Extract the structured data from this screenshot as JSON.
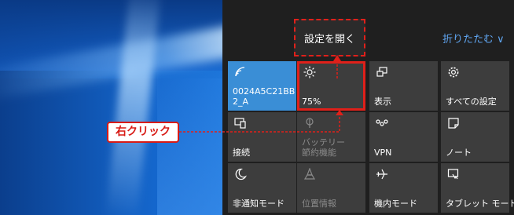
{
  "settings_popup": {
    "label": "設定を開く"
  },
  "collapse": {
    "label": "折りたたむ ∨"
  },
  "callout": {
    "label": "右クリック"
  },
  "tiles": [
    {
      "label": "0024A5C21BB\n2_A",
      "icon": "wifi-icon",
      "state": "active"
    },
    {
      "label": "75%",
      "icon": "brightness-icon",
      "state": "normal"
    },
    {
      "label": "表示",
      "icon": "project-icon",
      "state": "normal"
    },
    {
      "label": "すべての設定",
      "icon": "gear-icon",
      "state": "normal"
    },
    {
      "label": "接続",
      "icon": "connect-icon",
      "state": "normal"
    },
    {
      "label": "バッテリー\n節約機能",
      "icon": "battery-saver-icon",
      "state": "disabled"
    },
    {
      "label": "VPN",
      "icon": "vpn-icon",
      "state": "normal"
    },
    {
      "label": "ノート",
      "icon": "note-icon",
      "state": "normal"
    },
    {
      "label": "非通知モード",
      "icon": "moon-icon",
      "state": "normal"
    },
    {
      "label": "位置情報",
      "icon": "location-icon",
      "state": "disabled"
    },
    {
      "label": "機内モード",
      "icon": "airplane-icon",
      "state": "normal"
    },
    {
      "label": "タブレット モード",
      "icon": "tablet-mode-icon",
      "state": "normal"
    }
  ],
  "colors": {
    "highlight": "#e0201a",
    "active_tile": "#3a8ed6",
    "link": "#5fa4ef"
  }
}
